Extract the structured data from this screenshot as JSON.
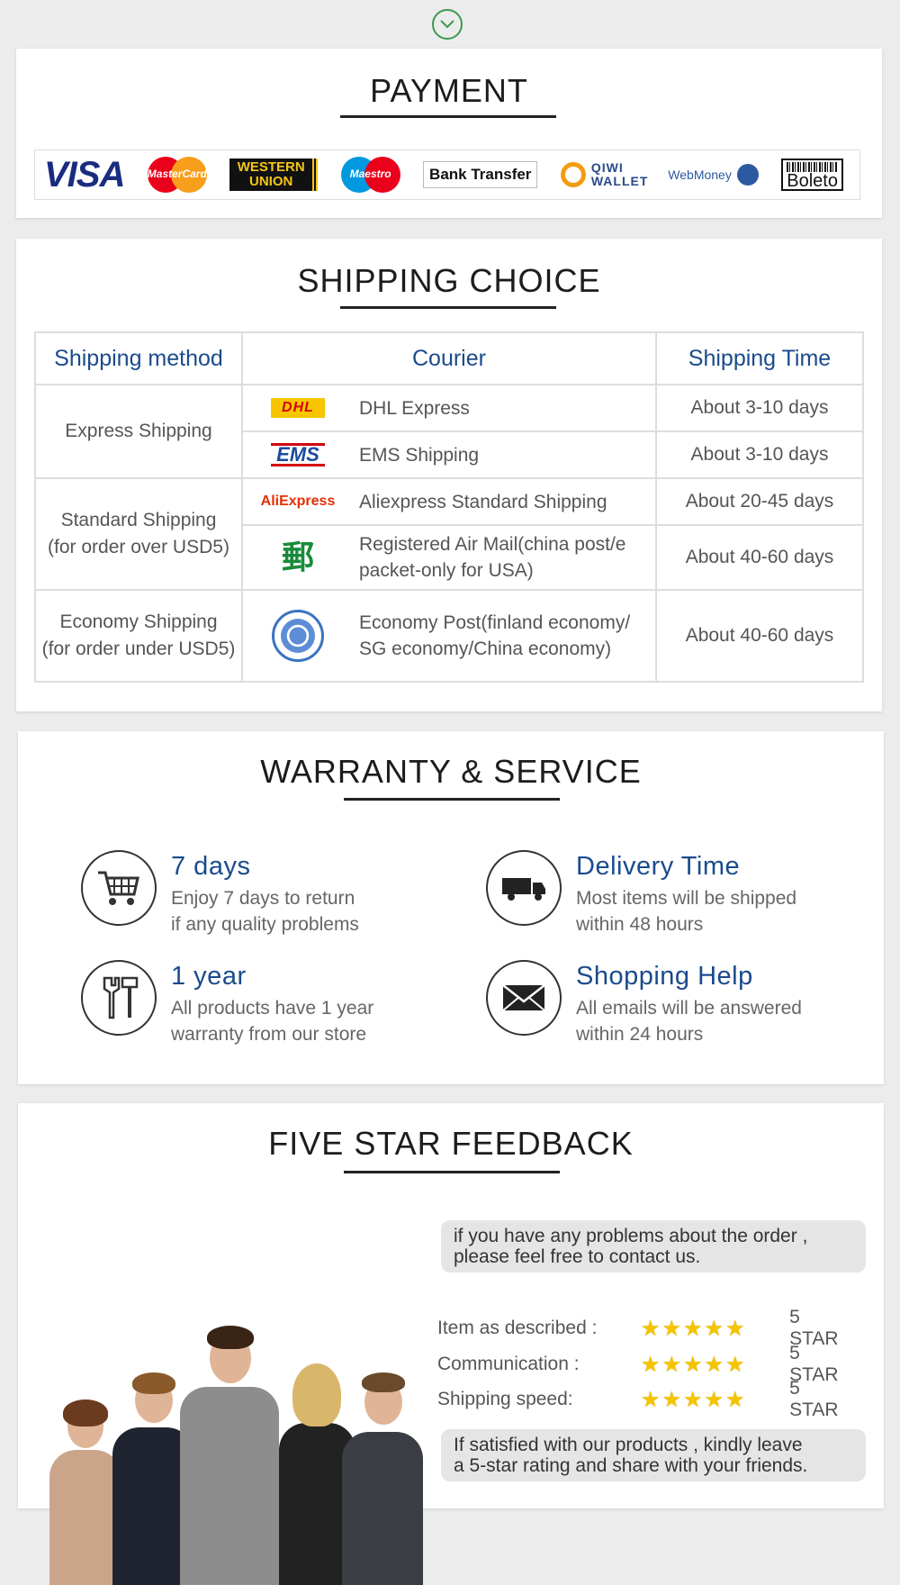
{
  "payment": {
    "title": "PAYMENT",
    "logos": {
      "visa": "VISA",
      "mastercard": "MasterCard",
      "western_union": "WESTERN UNION",
      "maestro": "Maestro",
      "bank_transfer": "Bank Transfer",
      "qiwi": "QIWI WALLET",
      "webmoney": "WebMoney",
      "boleto": "Boleto"
    }
  },
  "shipping": {
    "title": "SHIPPING CHOICE",
    "headers": [
      "Shipping method",
      "Courier",
      "Shipping Time"
    ],
    "groups": {
      "express": "Express Shipping",
      "standard": "Standard Shipping\n(for order over USD5)",
      "economy": "Economy Shipping\n(for order under USD5)"
    },
    "rows": [
      {
        "logo": "DHL",
        "courier": "DHL Express",
        "time": "About 3-10 days"
      },
      {
        "logo": "EMS",
        "courier": "EMS Shipping",
        "time": "About 3-10 days"
      },
      {
        "logo": "AliExpress",
        "courier": "Aliexpress Standard Shipping",
        "time": "About 20-45 days"
      },
      {
        "logo": "china-post-icon",
        "courier": "Registered Air Mail(china post/e\npacket-only for USA)",
        "time": "About 40-60 days"
      },
      {
        "logo": "un-emblem-icon",
        "courier": "Economy Post(finland economy/\nSG economy/China economy)",
        "time": "About 40-60 days"
      }
    ]
  },
  "warranty": {
    "title": "WARRANTY & SERVICE",
    "items": [
      {
        "icon": "shopping-cart-icon",
        "title": "7 days",
        "desc1": "Enjoy 7 days to return",
        "desc2": "if any quality problems"
      },
      {
        "icon": "delivery-truck-icon",
        "title": "Delivery Time",
        "desc1": "Most items will be shipped",
        "desc2": "within 48 hours"
      },
      {
        "icon": "tools-icon",
        "title": "1 year",
        "desc1": "All products have 1 year",
        "desc2": "warranty from our store"
      },
      {
        "icon": "envelope-icon",
        "title": "Shopping Help",
        "desc1": "All emails will be answered",
        "desc2": "within 24 hours"
      }
    ]
  },
  "feedback": {
    "title": "FIVE STAR FEEDBACK",
    "bubble_top": "if you have any problems about the order ,\nplease feel free to contact us.",
    "ratings": [
      {
        "label": "Item as described :",
        "value": "5 STAR",
        "stars": 5
      },
      {
        "label": "Communication :",
        "value": "5 STAR",
        "stars": 5
      },
      {
        "label": "Shipping speed:",
        "value": "5 STAR",
        "stars": 5
      }
    ],
    "bubble_bottom": "If satisfied with our products , kindly leave\na 5-star rating and share with your friends.",
    "star_glyphs": "★★★★★"
  }
}
